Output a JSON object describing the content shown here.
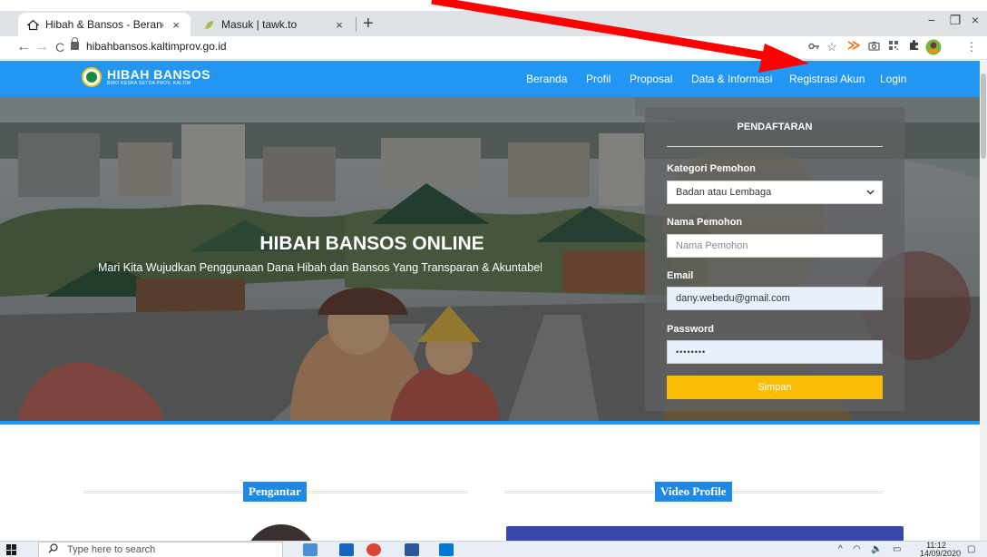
{
  "browser": {
    "tabs": [
      {
        "title": "Hibah & Bansos - Beranda - Inde",
        "close": "×",
        "icon": "home-outline-icon"
      },
      {
        "title": "Masuk | tawk.to",
        "close": "×",
        "icon": "tawk-leaf-icon"
      }
    ],
    "new_tab": "+",
    "window_controls": {
      "minimize": "−",
      "restore": "❐",
      "close": "×"
    },
    "nav": {
      "back": "←",
      "forward": "→",
      "reload": "C"
    },
    "url": "hibahbansos.kaltimprov.go.id",
    "extensions": [
      "key-icon",
      "star-icon",
      "extension-a-icon",
      "camera-icon",
      "qr-icon",
      "puzzle-icon",
      "profile-avatar-icon",
      "menu-kebab-icon"
    ]
  },
  "site": {
    "logo_title": "HIBAH BANSOS",
    "logo_subtitle": "BIRO KESRA SETDA PROV. KALTIM",
    "nav": [
      "Beranda",
      "Profil",
      "Proposal",
      "Data & Informasi",
      "Registrasi Akun",
      "Login"
    ]
  },
  "hero": {
    "title": "HIBAH BANSOS ONLINE",
    "subtitle": "Mari Kita Wujudkan Penggunaan Dana Hibah dan Bansos Yang Transparan & Akuntabel"
  },
  "form": {
    "title": "PENDAFTARAN",
    "kategori_label": "Kategori Pemohon",
    "kategori_value": "Badan atau Lembaga",
    "nama_label": "Nama Pemohon",
    "nama_placeholder": "Nama Pemohon",
    "email_label": "Email",
    "email_value": "dany.webedu@gmail.com",
    "password_label": "Password",
    "password_value": "••••••••",
    "submit": "Simpan"
  },
  "sections": {
    "pengantar": "Pengantar",
    "video": "Video Profile"
  },
  "taskbar": {
    "search_placeholder": "Type here to search",
    "time": "11:12",
    "date": "14/09/2020"
  },
  "colors": {
    "header_blue": "#2196f3",
    "button_yellow": "#fbbc05",
    "section_blue": "#1e88e5",
    "annotation_red": "#ff0000"
  }
}
